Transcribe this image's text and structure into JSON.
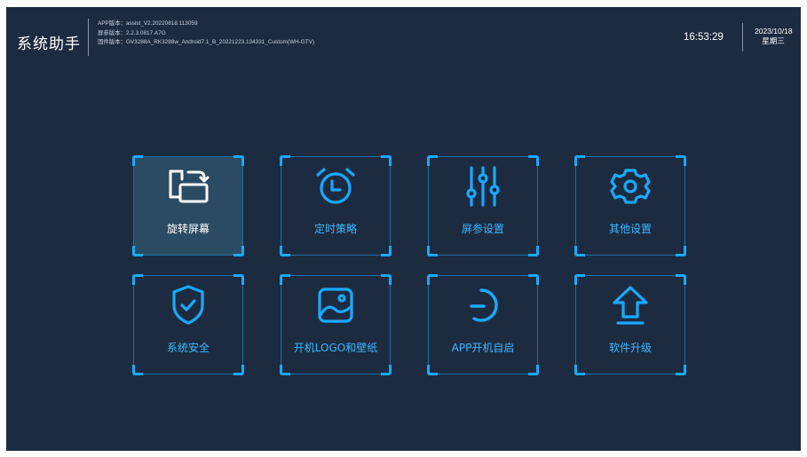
{
  "header": {
    "app_title": "系统助手",
    "app_version": "APP版本：assist_V2.20220818.113059",
    "screen_version": "屏参版本：2.2.3.0817.A7G",
    "firmware_version": "固件版本：GV3288A_RK3288w_Android7.1_B_20221223.134331_Custom(WH-GTV)",
    "time": "16:53:29",
    "date": "2023/10/18",
    "weekday": "星期三"
  },
  "colors": {
    "background": "#1d2b40",
    "accent": "#18a9ff",
    "active_tile": "#2b4b63",
    "text": "#ffffff"
  },
  "menu": {
    "tiles": [
      {
        "label": "旋转屏幕",
        "icon": "rotate-screen-icon",
        "selected": true
      },
      {
        "label": "定时策略",
        "icon": "alarm-clock-icon",
        "selected": false
      },
      {
        "label": "屏参设置",
        "icon": "sliders-icon",
        "selected": false
      },
      {
        "label": "其他设置",
        "icon": "gear-icon",
        "selected": false
      },
      {
        "label": "系统安全",
        "icon": "shield-check-icon",
        "selected": false
      },
      {
        "label": "开机LOGO和壁纸",
        "icon": "image-icon",
        "selected": false
      },
      {
        "label": "APP开机自启",
        "icon": "power-start-icon",
        "selected": false
      },
      {
        "label": "软件升级",
        "icon": "upgrade-arrow-icon",
        "selected": false
      }
    ]
  }
}
